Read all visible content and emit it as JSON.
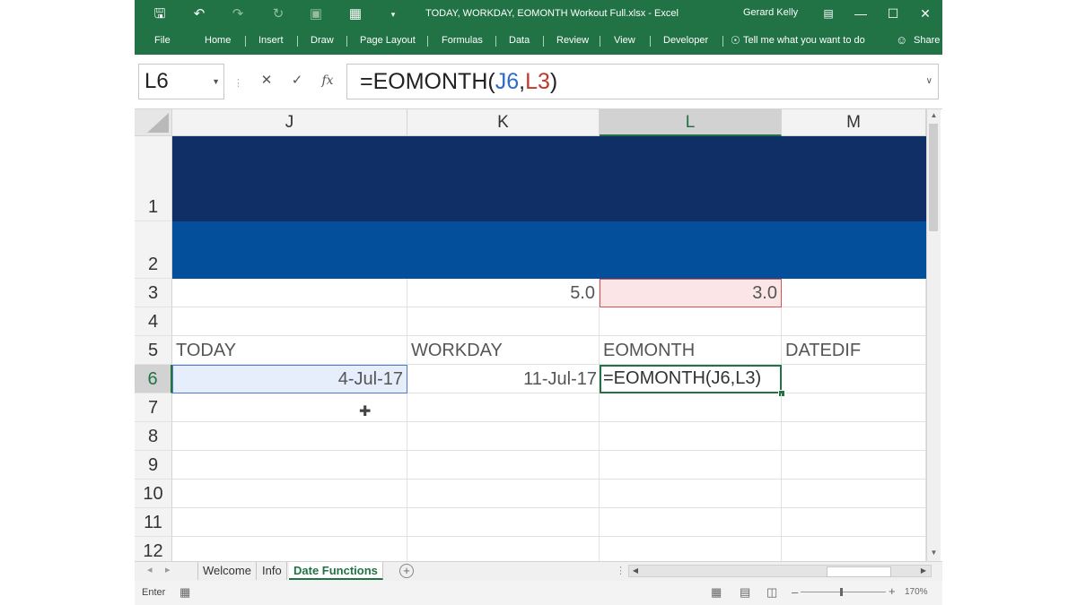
{
  "window": {
    "title": "TODAY, WORKDAY, EOMONTH Workout Full.xlsx  -  Excel",
    "user": "Gerard Kelly"
  },
  "ribbon_tabs": [
    "File",
    "Home",
    "Insert",
    "Draw",
    "Page Layout",
    "Formulas",
    "Data",
    "Review",
    "View",
    "Developer"
  ],
  "tell_me": "Tell me what you want to do",
  "share": "Share",
  "formula_bar": {
    "name_box": "L6",
    "formula_prefix": "=EOMONTH(",
    "ref1": "J6",
    "comma": ",",
    "ref2": "L3",
    "formula_suffix": ")"
  },
  "columns": [
    "J",
    "K",
    "L",
    "M"
  ],
  "rows": [
    "1",
    "2",
    "3",
    "4",
    "5",
    "6",
    "7",
    "8",
    "9",
    "10",
    "11",
    "12"
  ],
  "cells": {
    "K3": "5.0",
    "L3": "3.0",
    "J5": "TODAY",
    "K5": "WORKDAY",
    "L5": "EOMONTH",
    "M5": "DATEDIF",
    "J6": "4-Jul-17",
    "K6": "11-Jul-17",
    "L6": "=EOMONTH(J6,L3)"
  },
  "sheets": [
    "Welcome",
    "Info",
    "Date Functions"
  ],
  "active_sheet": "Date Functions",
  "status": {
    "mode": "Enter",
    "zoom": "170%"
  },
  "colors": {
    "excel_green": "#217346",
    "band_dark": "#102f66",
    "band_blue": "#034f9c"
  }
}
